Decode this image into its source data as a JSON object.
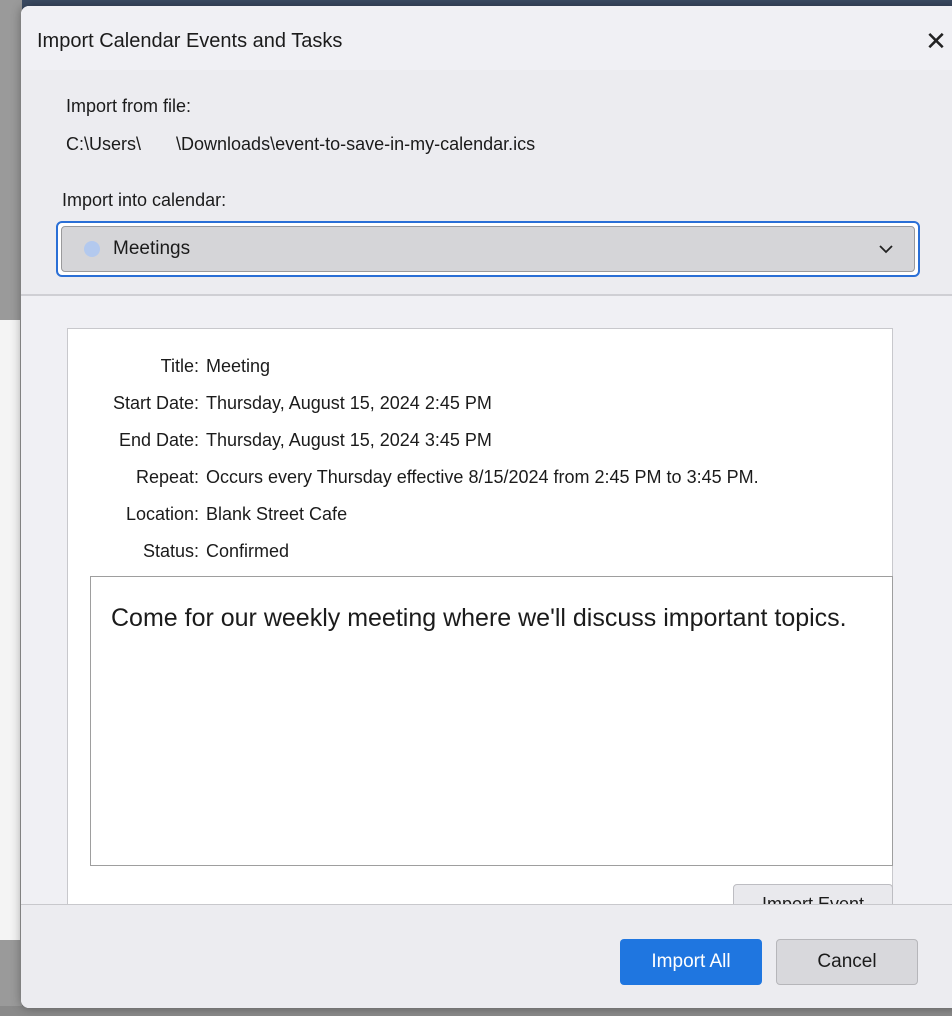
{
  "dialog": {
    "title": "Import Calendar Events and Tasks",
    "close_glyph": "✕"
  },
  "import": {
    "from_label": "Import from file:",
    "file_path": "C:\\Users\\       \\Downloads\\event-to-save-in-my-calendar.ics",
    "into_label": "Import into calendar:",
    "calendar": {
      "name": "Meetings",
      "dot_color": "#b3c9ee"
    }
  },
  "event": {
    "fields": [
      {
        "label": "Title:",
        "value": "Meeting"
      },
      {
        "label": "Start Date:",
        "value": "Thursday, August 15, 2024 2:45 PM"
      },
      {
        "label": "End Date:",
        "value": "Thursday, August 15, 2024 3:45 PM"
      },
      {
        "label": "Repeat:",
        "value": "Occurs every Thursday effective 8/15/2024 from 2:45 PM to 3:45 PM."
      },
      {
        "label": "Location:",
        "value": "Blank Street Cafe"
      },
      {
        "label": "Status:",
        "value": "Confirmed"
      }
    ],
    "description": "Come for our weekly meeting where we'll discuss important topics.",
    "import_event_label": "Import Event"
  },
  "footer": {
    "import_all_label": "Import All",
    "cancel_label": "Cancel"
  },
  "colors": {
    "accent": "#1f76e0",
    "focus_ring": "#2a6fd6"
  },
  "icons": {
    "close": "close-icon",
    "dropdown": "chevron-down-icon",
    "calendar_color": "calendar-color-dot"
  }
}
